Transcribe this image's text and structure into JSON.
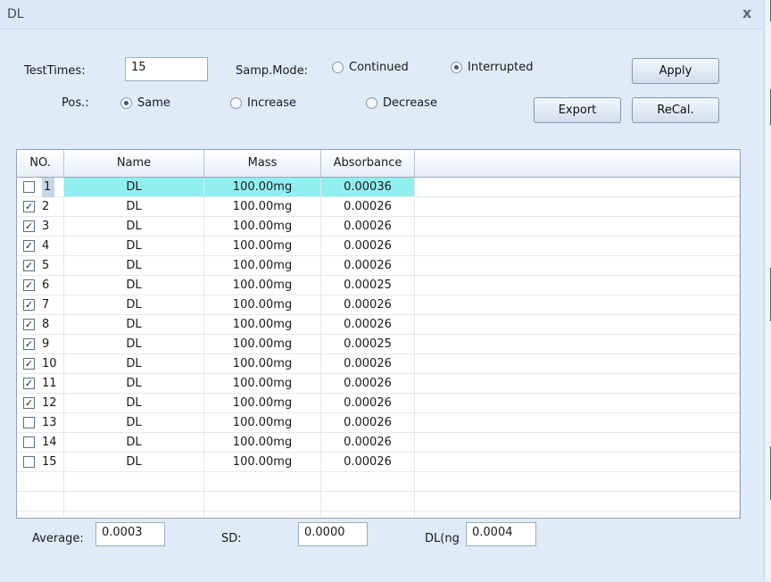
{
  "window": {
    "title": "DL",
    "close_glyph": "x"
  },
  "settings": {
    "test_times_label": "TestTimes:",
    "test_times_value": "15",
    "samp_mode_label": "Samp.Mode:",
    "samp_mode_options": [
      {
        "label": "Continued",
        "selected": false
      },
      {
        "label": "Interrupted",
        "selected": true
      }
    ],
    "pos_label": "Pos.:",
    "pos_options": [
      {
        "label": "Same",
        "selected": true
      },
      {
        "label": "Increase",
        "selected": false
      },
      {
        "label": "Decrease",
        "selected": false
      }
    ]
  },
  "buttons": {
    "apply": "Apply",
    "export": "Export",
    "recal": "ReCal."
  },
  "table": {
    "columns": [
      "NO.",
      "Name",
      "Mass",
      "Absorbance"
    ],
    "rows": [
      {
        "no": "1",
        "checked": false,
        "name": "DL",
        "mass": "100.00mg",
        "absorbance": "0.00036"
      },
      {
        "no": "2",
        "checked": true,
        "name": "DL",
        "mass": "100.00mg",
        "absorbance": "0.00026"
      },
      {
        "no": "3",
        "checked": true,
        "name": "DL",
        "mass": "100.00mg",
        "absorbance": "0.00026"
      },
      {
        "no": "4",
        "checked": true,
        "name": "DL",
        "mass": "100.00mg",
        "absorbance": "0.00026"
      },
      {
        "no": "5",
        "checked": true,
        "name": "DL",
        "mass": "100.00mg",
        "absorbance": "0.00026"
      },
      {
        "no": "6",
        "checked": true,
        "name": "DL",
        "mass": "100.00mg",
        "absorbance": "0.00025"
      },
      {
        "no": "7",
        "checked": true,
        "name": "DL",
        "mass": "100.00mg",
        "absorbance": "0.00026"
      },
      {
        "no": "8",
        "checked": true,
        "name": "DL",
        "mass": "100.00mg",
        "absorbance": "0.00026"
      },
      {
        "no": "9",
        "checked": true,
        "name": "DL",
        "mass": "100.00mg",
        "absorbance": "0.00025"
      },
      {
        "no": "10",
        "checked": true,
        "name": "DL",
        "mass": "100.00mg",
        "absorbance": "0.00026"
      },
      {
        "no": "11",
        "checked": true,
        "name": "DL",
        "mass": "100.00mg",
        "absorbance": "0.00026"
      },
      {
        "no": "12",
        "checked": true,
        "name": "DL",
        "mass": "100.00mg",
        "absorbance": "0.00026"
      },
      {
        "no": "13",
        "checked": false,
        "name": "DL",
        "mass": "100.00mg",
        "absorbance": "0.00026"
      },
      {
        "no": "14",
        "checked": false,
        "name": "DL",
        "mass": "100.00mg",
        "absorbance": "0.00026"
      },
      {
        "no": "15",
        "checked": false,
        "name": "DL",
        "mass": "100.00mg",
        "absorbance": "0.00026"
      }
    ],
    "selected_row": "1"
  },
  "summary": {
    "average_label": "Average:",
    "average_value": "0.0003",
    "sd_label": "SD:",
    "sd_value": "0.0000",
    "dl_label": "DL(ng",
    "dl_value": "0.0004"
  },
  "colors": {
    "highlight": "#8ff0ef",
    "selected_number": "#c6d5e6",
    "dialog_bg": "#dbe8f7"
  },
  "check_glyph": "✓"
}
